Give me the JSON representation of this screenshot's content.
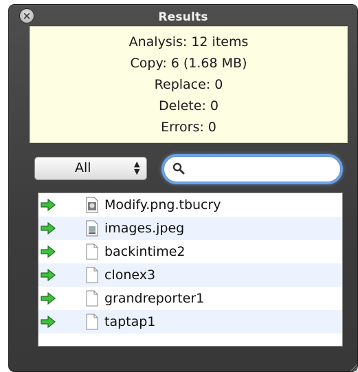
{
  "window": {
    "title": "Results"
  },
  "summary": {
    "analysis": "Analysis: 12 items",
    "copy": "Copy: 6 (1.68 MB)",
    "replace": "Replace: 0",
    "delete": "Delete: 0",
    "errors": "Errors: 0"
  },
  "filter": {
    "selected": "All"
  },
  "search": {
    "value": "",
    "placeholder": ""
  },
  "files": [
    {
      "name": "Modify.png.tbucry",
      "action": "copy",
      "icon": "image-file-icon"
    },
    {
      "name": "images.jpeg",
      "action": "copy",
      "icon": "jpeg-file-icon"
    },
    {
      "name": "backintime2",
      "action": "copy",
      "icon": "document-icon"
    },
    {
      "name": "clonex3",
      "action": "copy",
      "icon": "document-icon"
    },
    {
      "name": "grandreporter1",
      "action": "copy",
      "icon": "document-icon"
    },
    {
      "name": "taptap1",
      "action": "copy",
      "icon": "document-icon"
    }
  ],
  "colors": {
    "summary_bg": "#fefee3",
    "arrow_green": "#3ec23e",
    "row_alt": "#edf3fe",
    "search_focus": "#6aa2e6"
  }
}
